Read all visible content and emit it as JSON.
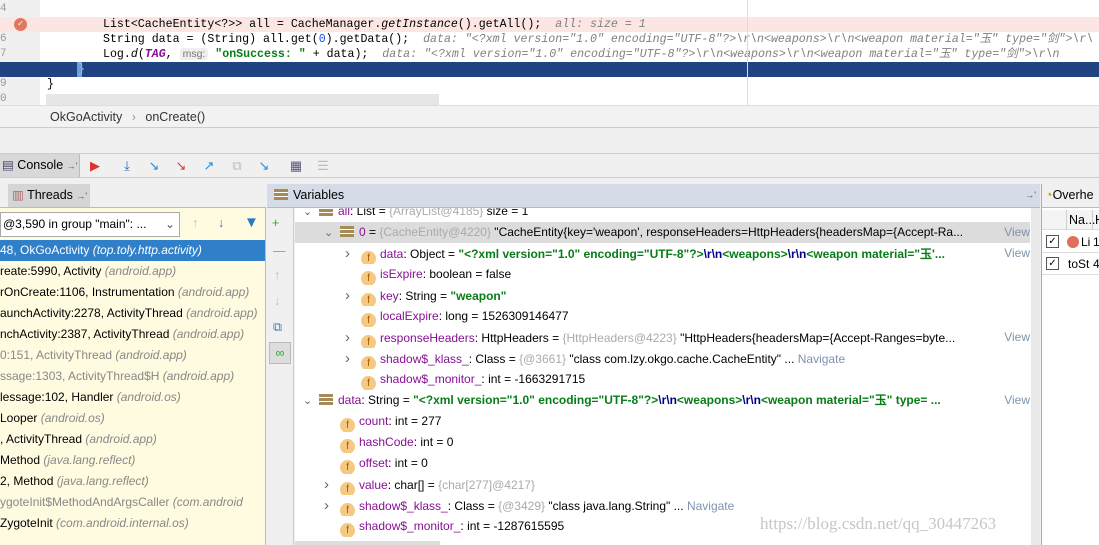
{
  "editor": {
    "line_numbers": [
      "4",
      "5",
      "6",
      "7",
      "8",
      "9",
      "0"
    ],
    "lines": [
      {
        "code": "List<CacheEntity<?>> all = CacheManager.",
        "italic": "getInstance",
        "rest": "().getAll();",
        "hint": "all:  size = 1"
      },
      {
        "code": "String data = (String) all.get(",
        "num": "0",
        "rest": ").getData();",
        "hint": "data: \"<?xml version=\"1.0\" encoding=\"UTF-8\"?>\\r\\n<weapons>\\r\\n<weapon material=\"玉\" type=\"剑\">\\r\\"
      },
      {
        "code": "Log.",
        "italic": "d",
        "rest2": "(",
        "tag": "TAG",
        "comma": ", ",
        "param": "msg:",
        "str": " \"onSuccess: \"",
        "rest": " + data);",
        "hint": "data: \"<?xml version=\"1.0\" encoding=\"UTF-8\"?>\\r\\n<weapons>\\r\\n<weapon material=\"玉\" type=\"剑\">\\r\\n"
      },
      {
        "code": "}"
      },
      {
        "code": "}"
      }
    ]
  },
  "breadcrumb": {
    "items": [
      "OkGoActivity",
      "onCreate()"
    ],
    "sep": "›"
  },
  "toolbar": {
    "console_tab": "Console",
    "pin": "→'"
  },
  "threads": {
    "tab": "Threads",
    "thread_select": "@3,590 in group \"main\": ...",
    "frames": [
      {
        "m": "48, OkGoActivity",
        "p": "(top.toly.http.activity)"
      },
      {
        "m": "reate:5990, Activity",
        "p": "(android.app)"
      },
      {
        "m": "rOnCreate:1106, Instrumentation",
        "p": "(android.app)"
      },
      {
        "m": "aunchActivity:2278, ActivityThread",
        "p": "(android.app)"
      },
      {
        "m": "nchActivity:2387, ActivityThread",
        "p": "(android.app)"
      },
      {
        "m": "0:151, ActivityThread",
        "p": "(android.app)"
      },
      {
        "m": "ssage:1303, ActivityThread$H",
        "p": "(android.app)"
      },
      {
        "m": "lessage:102, Handler",
        "p": "(android.os)"
      },
      {
        "m": " Looper",
        "p": "(android.os)"
      },
      {
        "m": ", ActivityThread",
        "p": "(android.app)"
      },
      {
        "m": " Method",
        "p": "(java.lang.reflect)"
      },
      {
        "m": "2, Method",
        "p": "(java.lang.reflect)"
      },
      {
        "m": "ygoteInit$MethodAndArgsCaller",
        "p": "(com.android"
      },
      {
        "m": " ZygoteInit",
        "p": "(com.android.internal.os)"
      }
    ]
  },
  "variables": {
    "title": "Variables",
    "view": "View",
    "navigate": "Navigate",
    "rows": [
      {
        "ind": 0,
        "arrow": "v",
        "icon": "list",
        "name": "all",
        "type": ": List",
        "eq": " = ",
        "ref": "{ArrayList@4185}",
        "val": " size = 1"
      },
      {
        "ind": 1,
        "arrow": "v",
        "icon": "list",
        "name": "0",
        "type": "",
        "eq": " = ",
        "ref": "{CacheEntity@4220}",
        "val": " \"CacheEntity{key='weapon', responseHeaders=HttpHeaders{headersMap={Accept-Ra...",
        "link": "View",
        "sel": true
      },
      {
        "ind": 2,
        "arrow": ">",
        "icon": "f",
        "name": "data",
        "type": ": Object",
        "eq": "  = ",
        "gs": "\"<?xml version=\"1.0\" encoding=\"UTF-8\"?>",
        "esc": "\\r\\n",
        "gs2": "<weapons>",
        "esc2": "\\r\\n",
        "gs3": "<weapon material=\"玉'...",
        "link": "View"
      },
      {
        "ind": 2,
        "arrow": "",
        "icon": "f",
        "name": "isExpire",
        "type": ": boolean",
        "eq": "  = ",
        "val": "false"
      },
      {
        "ind": 2,
        "arrow": ">",
        "icon": "f",
        "name": "key",
        "type": ": String",
        "eq": "  = ",
        "gs": "\"weapon\""
      },
      {
        "ind": 2,
        "arrow": "",
        "icon": "f",
        "name": "localExpire",
        "type": ": long",
        "eq": "  = ",
        "val": "1526309146477"
      },
      {
        "ind": 2,
        "arrow": ">",
        "icon": "f",
        "name": "responseHeaders",
        "type": ": HttpHeaders",
        "eq": "  = ",
        "ref": "{HttpHeaders@4223}",
        "val": " \"HttpHeaders{headersMap={Accept-Ranges=byte...",
        "link": "View"
      },
      {
        "ind": 2,
        "arrow": ">",
        "icon": "f",
        "name": "shadow$_klass_",
        "type": ": Class",
        "eq": "  = ",
        "ref": "{@3661}",
        "val": " \"class com.lzy.okgo.cache.CacheEntity\" ...",
        "nav": "Navigate"
      },
      {
        "ind": 2,
        "arrow": "",
        "icon": "f",
        "name": "shadow$_monitor_",
        "type": ": int",
        "eq": "  = ",
        "val": "-1663291715"
      },
      {
        "ind": 0,
        "arrow": "v",
        "icon": "list",
        "name": "data",
        "type": ": String",
        "eq": "  = ",
        "gs": "\"<?xml version=\"1.0\" encoding=\"UTF-8\"?>",
        "esc": "\\r\\n",
        "gs2": "<weapons>",
        "esc2": "\\r\\n",
        "gs3": "<weapon material=\"玉\" type= ...",
        "link": "View"
      },
      {
        "ind": 1,
        "arrow": "",
        "icon": "f",
        "name": "count",
        "type": ": int",
        "eq": "  = ",
        "val": "277"
      },
      {
        "ind": 1,
        "arrow": "",
        "icon": "f",
        "name": "hashCode",
        "type": ": int",
        "eq": "  = ",
        "val": "0"
      },
      {
        "ind": 1,
        "arrow": "",
        "icon": "f",
        "name": "offset",
        "type": ": int",
        "eq": "  = ",
        "val": "0"
      },
      {
        "ind": 1,
        "arrow": ">",
        "icon": "f",
        "name": "value",
        "type": ": char[]",
        "eq": "  = ",
        "ref": "{char[277]@4217}"
      },
      {
        "ind": 1,
        "arrow": ">",
        "icon": "f",
        "name": "shadow$_klass_",
        "type": ": Class",
        "eq": "  = ",
        "ref": "{@3429}",
        "val": " \"class java.lang.String\" ...",
        "nav": "Navigate"
      },
      {
        "ind": 1,
        "arrow": "",
        "icon": "f",
        "name": "shadow$_monitor_",
        "type": ": int",
        "eq": "  = ",
        "val": "-1287615595"
      }
    ]
  },
  "overhead": {
    "title": "Overhe",
    "col_name": "Na...",
    "col_h": "H",
    "rows": [
      {
        "name": "Li",
        "v": "1",
        "checked": true
      },
      {
        "name": "toSt",
        "v": "4",
        "checked": true
      }
    ]
  },
  "watermark": "https://blog.csdn.net/qq_30447263",
  "colors": {
    "selection": "#2f7fc9",
    "breakpoint_line": "#fbe6e4",
    "current_line": "#214283",
    "string_green": "#067d17"
  }
}
